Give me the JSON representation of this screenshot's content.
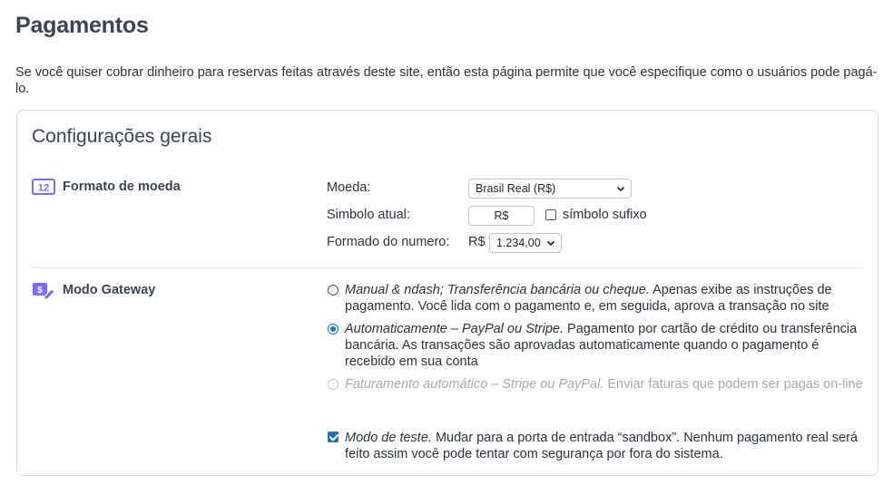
{
  "page": {
    "title": "Pagamentos",
    "description": "Se você quiser cobrar dinheiro para reservas feitas através deste site, então esta página permite que você especifique como o usuários pode pagá-lo."
  },
  "card": {
    "title": "Configurações gerais",
    "currency_section": {
      "label": "Formato de moeda",
      "icon": "number-12-icon",
      "icon_text": "12",
      "currency": {
        "label": "Moeda:",
        "value": "Brasil Real (R$)"
      },
      "symbol": {
        "label": "Simbolo atual:",
        "value": "R$",
        "suffix_label": "símbolo sufixo",
        "suffix_checked": false
      },
      "number_format": {
        "label": "Formado do numero:",
        "prefix": "R$",
        "value": "1.234,00"
      }
    },
    "gateway_section": {
      "label": "Modo Gateway",
      "icon": "payment-edit-icon",
      "options": [
        {
          "title": "Manual & ndash; Transferência bancária ou cheque.",
          "desc": " Apenas exibe as instruções de pagamento. Você lida com o pagamento e, em seguida, aprova a transação no site",
          "checked": false,
          "disabled": false
        },
        {
          "title": "Automaticamente – PayPal ou Stripe.",
          "desc": " Pagamento por cartão de crédito ou transferência bancária. As transações são aprovadas automaticamente quando o pagamento é recebido em sua conta",
          "checked": true,
          "disabled": false
        },
        {
          "title": "Faturamento automático – Stripe ou PayPal.",
          "desc": " Enviar faturas que podem ser pagas on-line",
          "checked": false,
          "disabled": true
        }
      ],
      "test_mode": {
        "title": "Modo de teste.",
        "desc": " Mudar para a porta de entrada “sandbox”. Nenhum pagamento real será feito assim você pode tentar com segurança por fora do sistema.",
        "checked": true
      }
    }
  },
  "colors": {
    "accent": "#2271b1",
    "icon_purple": "#7b6cf6"
  }
}
